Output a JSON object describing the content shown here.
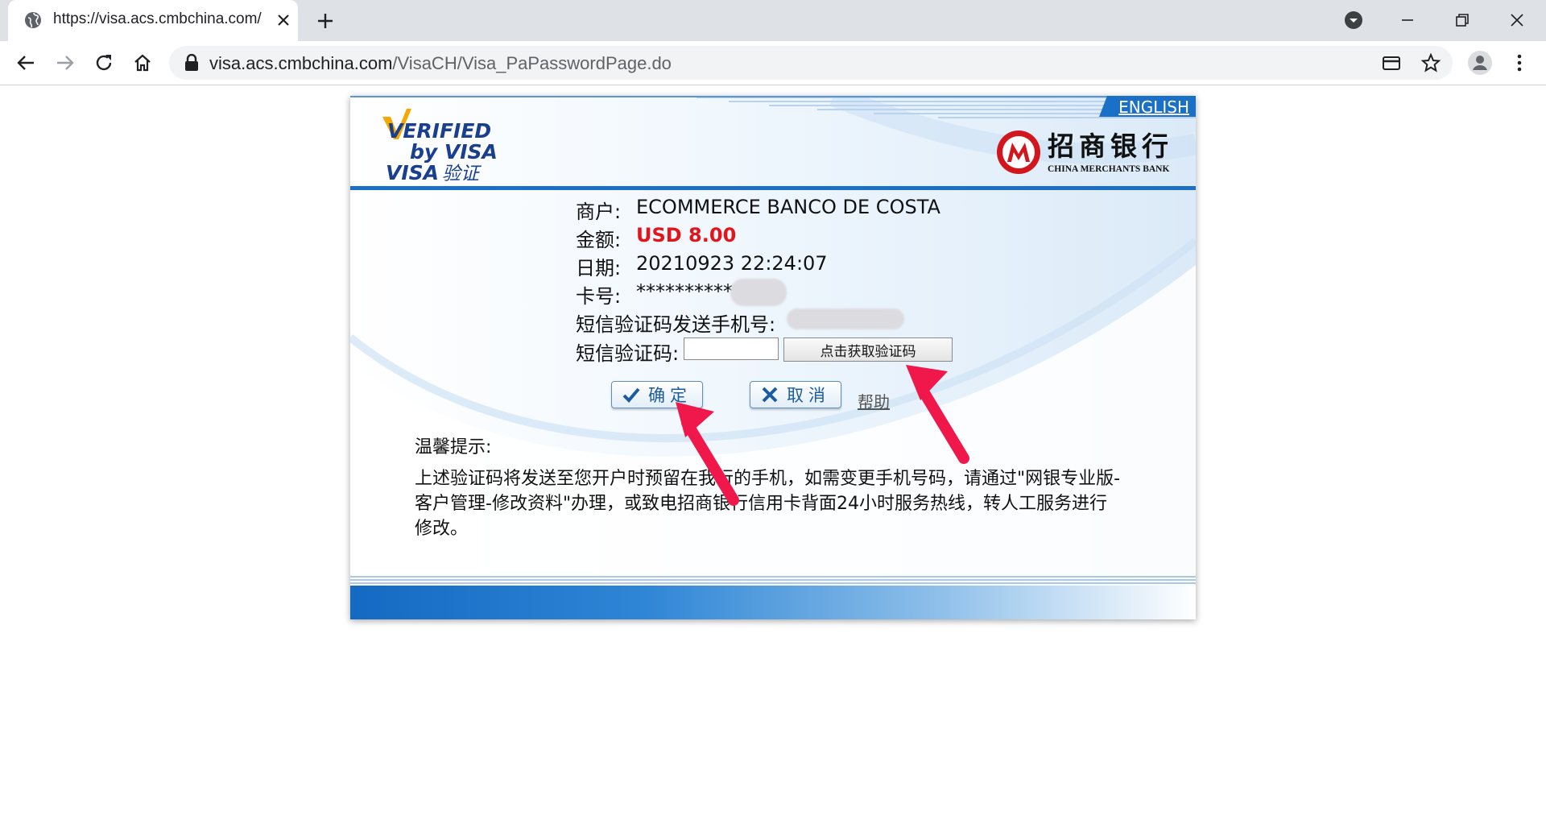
{
  "browser": {
    "tab_title": "https://visa.acs.cmbchina.com/",
    "url_host": "visa.acs.cmbchina.com",
    "url_path": "/VisaCH/Visa_PaPasswordPage.do"
  },
  "page": {
    "english_link": "ENGLISH",
    "visa_logo": {
      "line1": "VERIFIED",
      "line2": "by VISA",
      "line3_en": "VISA",
      "line3_cn": "验证"
    },
    "bank_logo": {
      "name_cn": "招商银行",
      "name_en": "CHINA MERCHANTS BANK"
    },
    "details": {
      "merchant_label": "商户:",
      "merchant_value": "ECOMMERCE BANCO DE COSTA",
      "amount_label": "金额:",
      "amount_value": "USD 8.00",
      "date_label": "日期:",
      "date_value": "20210923 22:24:07",
      "card_label": "卡号:",
      "card_value": "***********",
      "sms_phone_label": "短信验证码发送手机号:",
      "sms_code_label": "短信验证码:",
      "get_code_button": "点击获取验证码"
    },
    "actions": {
      "confirm_label": "确定",
      "cancel_label": "取消",
      "help_label": "帮助"
    },
    "notice": {
      "title": "温馨提示:",
      "body": "上述验证码将发送至您开户时预留在我行的手机，如需变更手机号码，请通过\"网银专业版-客户管理-修改资料\"办理，或致电招商银行信用卡背面24小时服务热线，转人工服务进行修改。"
    },
    "colors": {
      "amount": "#e4141b",
      "header_rule": "#1a6fc6",
      "annotation_arrow": "#f0184a"
    }
  }
}
